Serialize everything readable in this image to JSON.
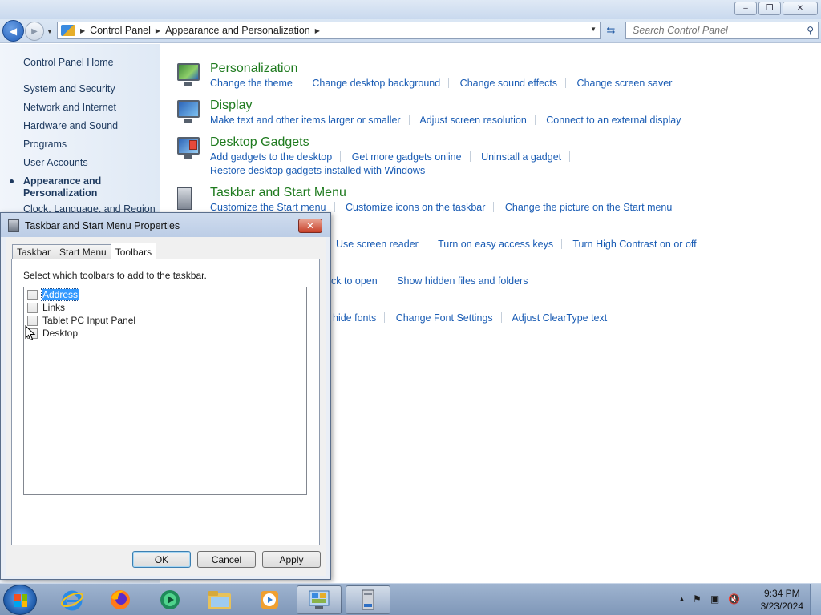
{
  "window": {
    "min_label": "–",
    "max_label": "❐",
    "close_label": "✕"
  },
  "navigation": {
    "back_glyph": "◀",
    "forward_glyph": "▶",
    "breadcrumbs": [
      "Control Panel",
      "Appearance and Personalization"
    ],
    "search_placeholder": "Search Control Panel"
  },
  "sidebar": {
    "home": "Control Panel Home",
    "items": [
      {
        "label": "System and Security"
      },
      {
        "label": "Network and Internet"
      },
      {
        "label": "Hardware and Sound"
      },
      {
        "label": "Programs"
      },
      {
        "label": "User Accounts"
      }
    ],
    "active_line1": "Appearance and",
    "active_line2": "Personalization",
    "clock_partial": "Clock, Language, and Region"
  },
  "categories": {
    "personalization": {
      "title": "Personalization",
      "links": [
        "Change the theme",
        "Change desktop background",
        "Change sound effects",
        "Change screen saver"
      ]
    },
    "display": {
      "title": "Display",
      "links": [
        "Make text and other items larger or smaller",
        "Adjust screen resolution",
        "Connect to an external display"
      ]
    },
    "gadgets": {
      "title": "Desktop Gadgets",
      "links": [
        "Add gadgets to the desktop",
        "Get more gadgets online",
        "Uninstall a gadget"
      ],
      "links2": [
        "Restore desktop gadgets installed with Windows"
      ]
    },
    "taskbar": {
      "title": "Taskbar and Start Menu",
      "links": [
        "Customize the Start menu",
        "Customize icons on the taskbar",
        "Change the picture on the Start menu"
      ]
    },
    "ease_partial": [
      "Use screen reader",
      "Turn on easy access keys",
      "Turn High Contrast on or off"
    ],
    "folder_partial": [
      "ck to open",
      "Show hidden files and folders"
    ],
    "fonts_partial": [
      "hide fonts",
      "Change Font Settings",
      "Adjust ClearType text"
    ]
  },
  "dialog": {
    "title": "Taskbar and Start Menu Properties",
    "close_glyph": "✕",
    "tabs": [
      "Taskbar",
      "Start Menu",
      "Toolbars"
    ],
    "active_tab": "Toolbars",
    "instruction": "Select which toolbars to add to the taskbar.",
    "toolbars": [
      {
        "label": "Address",
        "checked": false,
        "selected": true
      },
      {
        "label": "Links",
        "checked": false,
        "selected": false
      },
      {
        "label": "Tablet PC Input Panel",
        "checked": false,
        "selected": false
      },
      {
        "label": "Desktop",
        "checked": false,
        "selected": false
      }
    ],
    "buttons": {
      "ok": "OK",
      "cancel": "Cancel",
      "apply": "Apply"
    }
  },
  "taskbar": {
    "apps": [
      "internet-explorer",
      "firefox",
      "media-center",
      "windows-explorer",
      "media-player",
      "control-panel",
      "taskbar-properties"
    ],
    "tray": {
      "time": "9:34 PM",
      "date": "3/23/2024"
    }
  },
  "colors": {
    "link": "#1a5cb4",
    "category_title": "#1e7a1e",
    "selection": "#3399ff"
  }
}
